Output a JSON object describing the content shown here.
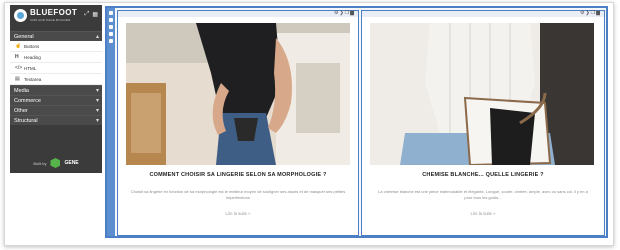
{
  "sidebar": {
    "brand": "BLUEFOOT",
    "tagline": "CMS AND PAGE BUILDER",
    "sections": {
      "general": "General",
      "media": "Media",
      "commerce": "Commerce",
      "other": "Other",
      "structural": "Structural"
    },
    "items": [
      "Buttons",
      "Heading",
      "HTML",
      "Textarea"
    ],
    "built_by": "Built by",
    "gene": "GENE"
  },
  "cards": [
    {
      "title": "COMMENT CHOISIR SA LINGERIE SELON SA MORPHOLOGIE ?",
      "text": "Choisir sa lingerie en fonction de sa morphologie est le meilleur moyen de souligner ses atouts et de masquer ses petites imperfections",
      "more": "Lire la suite »"
    },
    {
      "title": "CHEMISE BLANCHE... QUELLE LINGERIE ?",
      "text": "La chemise blanche est une pièce indémodable et élégante. Longue, courte, cintrée, ample, avec ou sans col, il y en a pour tous les goûts...",
      "more": "Lire la suite »"
    }
  ],
  "colors": {
    "accent": "#4d7fc4",
    "panel": "#3b3b3b",
    "gene": "#55b54a"
  }
}
